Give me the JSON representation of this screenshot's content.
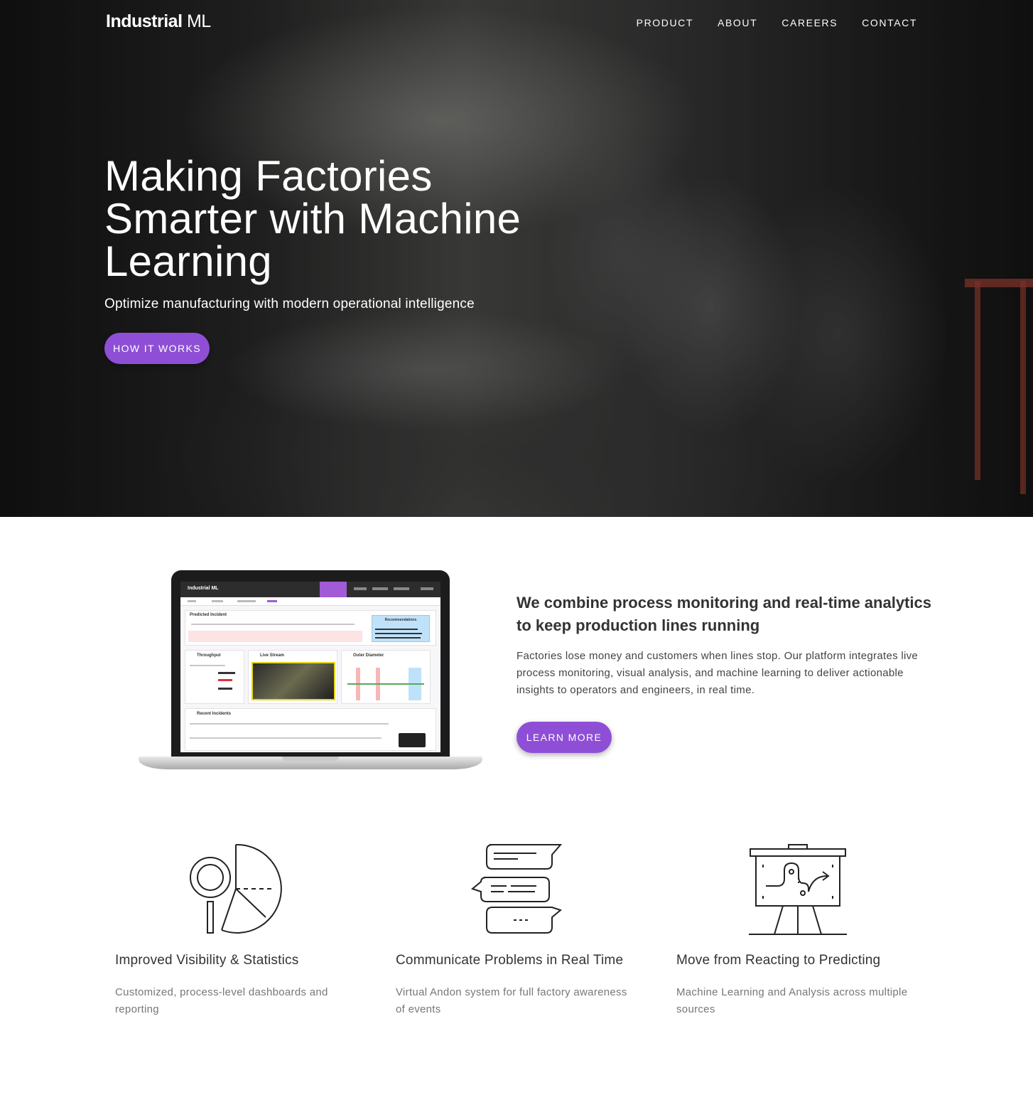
{
  "header": {
    "brand_bold": "Industrial",
    "brand_light": " ML",
    "nav": [
      "PRODUCT",
      "ABOUT",
      "CAREERS",
      "CONTACT"
    ]
  },
  "hero": {
    "title": "Making Factories Smarter with Machine Learning",
    "subtitle": "Optimize manufacturing with modern operational intelligence",
    "button": "HOW IT WORKS"
  },
  "intro": {
    "title": "We combine process monitoring and real-time analytics to keep production lines running",
    "body": "Factories lose money and customers when lines stop. Our platform integrates live process monitoring, visual analysis, and machine learning to deliver actionable insights to operators and engineers, in real time.",
    "button": "LEARN MORE",
    "laptop_screen": {
      "app_name": "Industrial ML",
      "predicted_incident": "Predicted Incident",
      "recommendations": "Recommendations",
      "throughput": "Throughput",
      "live_stream": "Live Stream",
      "outer_diameter": "Outer Diameter",
      "recent_incidents": "Recent Incidents"
    }
  },
  "features": [
    {
      "icon": "magnifier-pie-chart-icon",
      "title": "Improved Visibility & Statistics",
      "text": "Customized, process-level dashboards and reporting"
    },
    {
      "icon": "chat-bubbles-icon",
      "title": "Communicate Problems in Real Time",
      "text": "Virtual Andon system for full factory awareness of events"
    },
    {
      "icon": "presentation-board-icon",
      "title": "Move from Reacting to Predicting",
      "text": "Machine Learning and Analysis across multiple sources"
    }
  ],
  "colors": {
    "accent": "#8e4fd6",
    "text": "#333333",
    "muted": "#777777"
  }
}
